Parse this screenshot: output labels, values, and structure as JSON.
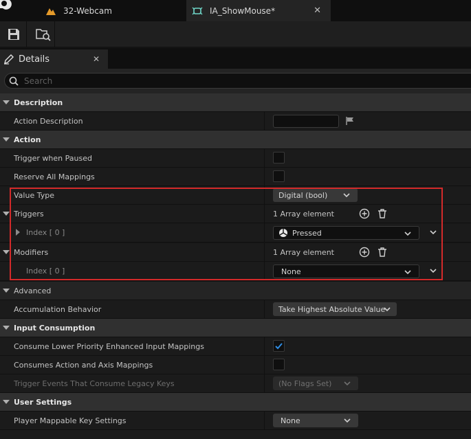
{
  "tabs": [
    {
      "label": "32-Webcam",
      "icon": "level-icon"
    },
    {
      "label": "IA_ShowMouse*",
      "icon": "input-action-icon"
    }
  ],
  "details": {
    "tab_label": "Details",
    "close_glyph": "✕"
  },
  "search": {
    "placeholder": "Search"
  },
  "categories": {
    "description": "Description",
    "action": "Action",
    "advanced": "Advanced",
    "input_consumption": "Input Consumption",
    "user_settings": "User Settings"
  },
  "properties": {
    "action_description": {
      "label": "Action Description",
      "value": ""
    },
    "trigger_when_paused": {
      "label": "Trigger when Paused",
      "checked": false
    },
    "reserve_all_mappings": {
      "label": "Reserve All Mappings",
      "checked": false
    },
    "value_type": {
      "label": "Value Type",
      "value": "Digital (bool)"
    },
    "triggers": {
      "label": "Triggers",
      "count": "1 Array element",
      "index_label": "Index [ 0 ]",
      "value": "Pressed"
    },
    "modifiers": {
      "label": "Modifiers",
      "count": "1 Array element",
      "index_label": "Index [ 0 ]",
      "value": "None"
    },
    "accumulation_behavior": {
      "label": "Accumulation Behavior",
      "value": "Take Highest Absolute Value"
    },
    "consume_lower_priority": {
      "label": "Consume Lower Priority Enhanced Input Mappings",
      "checked": true
    },
    "consumes_action_axis": {
      "label": "Consumes Action and Axis Mappings",
      "checked": false
    },
    "trigger_events_legacy": {
      "label": "Trigger Events That Consume Legacy Keys",
      "value": "(No Flags Set)"
    },
    "player_mappable": {
      "label": "Player Mappable Key Settings",
      "value": "None"
    }
  },
  "colors": {
    "highlight": "#d42a2a",
    "accent_check": "#2f8de4"
  }
}
